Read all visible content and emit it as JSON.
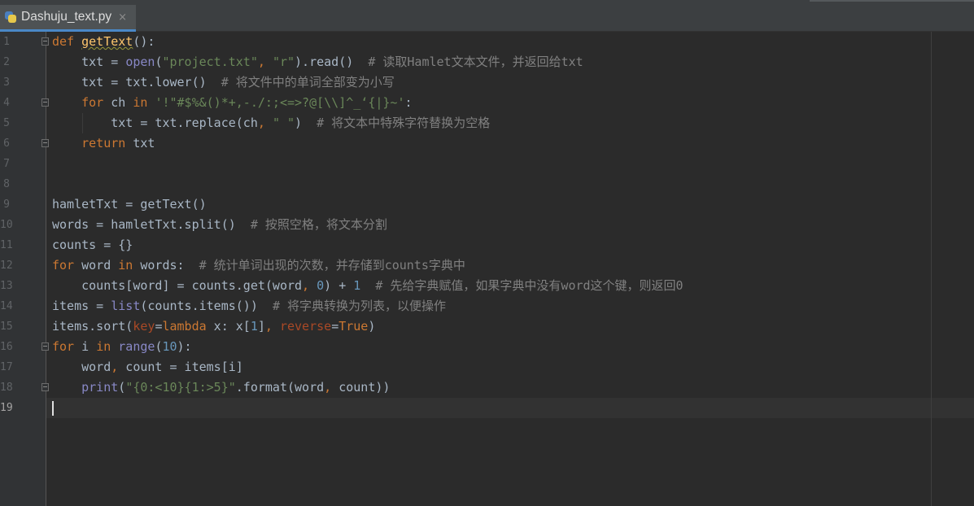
{
  "tab": {
    "filename": "Dashuju_text.py",
    "close": "×",
    "icon": "python-file-icon"
  },
  "editor": {
    "language": "python",
    "current_line": 19,
    "lines": [
      {
        "n": "1"
      },
      {
        "n": "2"
      },
      {
        "n": "3"
      },
      {
        "n": "4"
      },
      {
        "n": "5"
      },
      {
        "n": "6"
      },
      {
        "n": "7"
      },
      {
        "n": "8"
      },
      {
        "n": "9"
      },
      {
        "n": "10"
      },
      {
        "n": "11"
      },
      {
        "n": "12"
      },
      {
        "n": "13"
      },
      {
        "n": "14"
      },
      {
        "n": "15"
      },
      {
        "n": "16"
      },
      {
        "n": "17"
      },
      {
        "n": "18"
      },
      {
        "n": "19"
      }
    ],
    "code": {
      "l1": {
        "def": "def ",
        "name": "getText",
        "rest": "():"
      },
      "l2": {
        "a": "    txt = ",
        "open": "open",
        "b": "(",
        "s1": "\"project.txt\"",
        "c": ", ",
        "s2": "\"r\"",
        "d": ").read()  ",
        "cmt": "# 读取Hamlet文本文件，并返回给txt"
      },
      "l3": {
        "a": "    txt = txt.lower()  ",
        "cmt": "# 将文件中的单词全部变为小写"
      },
      "l4": {
        "for": "    for",
        "a": " ch ",
        "in": "in",
        "b": " ",
        "s": "'!\"#$%&()*+,-./:;<=>?@[\\\\]^_‘{|}~'",
        "c": ":"
      },
      "l5": {
        "a": "        txt = txt.replace(ch",
        "comma": ",",
        "b": " ",
        "s": "\" \"",
        "c": ")  ",
        "cmt": "# 将文本中特殊字符替换为空格"
      },
      "l6": {
        "ret": "    return",
        "a": " txt"
      },
      "l9": {
        "a": "hamletTxt = getText()"
      },
      "l10": {
        "a": "words = hamletTxt.split()  ",
        "cmt": "# 按照空格，将文本分割"
      },
      "l11": {
        "a": "counts = {}"
      },
      "l12": {
        "for": "for",
        "a": " word ",
        "in": "in",
        "b": " words:  ",
        "cmt": "# 统计单词出现的次数，并存储到counts字典中"
      },
      "l13": {
        "a": "    counts[word] = counts.get(word",
        "comma": ",",
        "b": " ",
        "n0": "0",
        "c": ") + ",
        "n1": "1",
        "d": "  ",
        "cmt": "# 先给字典赋值，如果字典中没有word这个键，则返回0"
      },
      "l14": {
        "a": "items = ",
        "list": "list",
        "b": "(counts.items())  ",
        "cmt": "# 将字典转换为列表，以便操作"
      },
      "l15": {
        "a": "items.sort(",
        "key": "key",
        "eq": "=",
        "lambda": "lambda",
        "b": " x: x[",
        "n": "1",
        "c": "]",
        "comma": ",",
        "d": " ",
        "rev": "reverse",
        "eq2": "=",
        "true": "True",
        "e": ")"
      },
      "l16": {
        "for": "for",
        "a": " i ",
        "in": "in",
        "b": " ",
        "range": "range",
        "c": "(",
        "n": "10",
        "d": "):"
      },
      "l17": {
        "a": "    word",
        "comma": ",",
        "b": " count = items[i]"
      },
      "l18": {
        "a": "    ",
        "print": "print",
        "b": "(",
        "s": "\"{0:<10}{1:>5}\"",
        "c": ".format(word",
        "comma": ",",
        "d": " count))"
      }
    }
  },
  "colors": {
    "background": "#2b2b2b",
    "gutter": "#313335",
    "keyword": "#cc7832",
    "function": "#ffc66d",
    "builtin": "#8888c6",
    "string": "#6a8759",
    "number": "#6897bb",
    "comment": "#808080",
    "param": "#aa4926",
    "accent": "#4a88c7"
  }
}
